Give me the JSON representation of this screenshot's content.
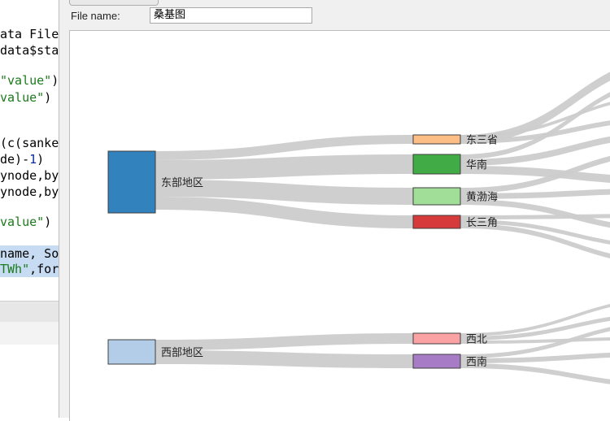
{
  "editor": {
    "lines": [
      {
        "text": "ata File",
        "parts": [
          [
            "ata File",
            ""
          ]
        ]
      },
      {
        "text": "data$sta",
        "parts": [
          [
            "data$sta",
            ""
          ]
        ]
      },
      {
        "text": "",
        "parts": []
      },
      {
        "text": "\"value\")",
        "parts": [
          [
            "\"value\"",
            "str"
          ],
          [
            ")",
            ""
          ]
        ]
      },
      {
        "text": "value\")",
        "parts": [
          [
            "value\"",
            "str"
          ],
          [
            ")",
            ""
          ]
        ]
      },
      {
        "text": "",
        "parts": []
      },
      {
        "text": "",
        "parts": []
      },
      {
        "text": "(c(sanke",
        "parts": [
          [
            "(c(sanke",
            ""
          ]
        ]
      },
      {
        "text": "de)-1)",
        "parts": [
          [
            "de)-",
            ""
          ],
          [
            "1",
            "num"
          ],
          [
            ")",
            ""
          ]
        ]
      },
      {
        "text": "ynode,by",
        "parts": [
          [
            "ynode,by",
            ""
          ]
        ]
      },
      {
        "text": "ynode,by",
        "parts": [
          [
            "ynode,by",
            ""
          ]
        ]
      },
      {
        "text": "",
        "parts": []
      },
      {
        "text": "value\")",
        "parts": [
          [
            "value\"",
            "str"
          ],
          [
            ")",
            ""
          ]
        ]
      },
      {
        "text": "",
        "parts": []
      },
      {
        "text": "name, So",
        "parts": [
          [
            "name, So",
            ""
          ]
        ],
        "selected": true
      },
      {
        "text": "TWh\",for",
        "parts": [
          [
            "TWh\"",
            "str"
          ],
          [
            ",for",
            ""
          ]
        ],
        "selected": true
      }
    ]
  },
  "dialog": {
    "file_name_label": "File name:",
    "file_name_value": "桑基图"
  },
  "sankey": {
    "link_color": "#cccccc",
    "sources": [
      {
        "name": "东部地区",
        "color": "#3182bd"
      },
      {
        "name": "西部地区",
        "color": "#b3cde8"
      }
    ],
    "targets": [
      {
        "name": "东三省",
        "color": "#fdbe85"
      },
      {
        "name": "华南",
        "color": "#41ab45"
      },
      {
        "name": "黄渤海",
        "color": "#a1de97"
      },
      {
        "name": "长三角",
        "color": "#d63a3b"
      },
      {
        "name": "西北",
        "color": "#fba2a4"
      },
      {
        "name": "西南",
        "color": "#a87bc6"
      }
    ]
  }
}
